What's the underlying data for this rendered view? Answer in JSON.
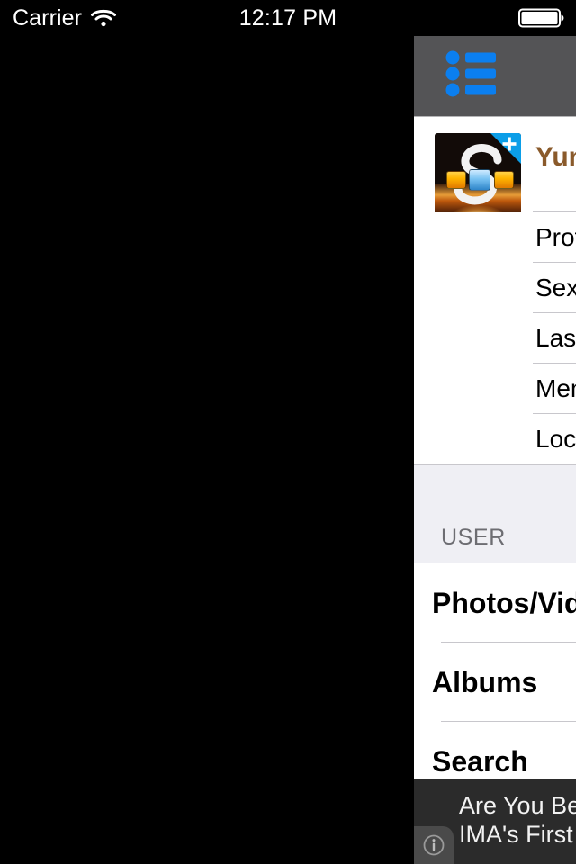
{
  "status_bar": {
    "carrier": "Carrier",
    "wifi_icon": "wifi-icon",
    "time": "12:17 PM",
    "battery_icon": "battery-icon"
  },
  "nav_bar": {
    "background": "#545456",
    "list_button_icon": "list-bullets-icon",
    "icon_color": "#0b7ff0"
  },
  "profile": {
    "avatar_icon": "app-logo-avatar",
    "avatar_badge_icon": "plus-badge-icon",
    "name": "Yunus Emre",
    "name_color": "#8a5a2b"
  },
  "profile_rows": [
    {
      "label": "Profile"
    },
    {
      "label": "Sex"
    },
    {
      "label": "Last Online"
    },
    {
      "label": "Member Since"
    },
    {
      "label": "Location"
    }
  ],
  "section": {
    "title": "USER"
  },
  "user_rows": [
    {
      "label": "Photos/Videos"
    },
    {
      "label": "Albums"
    },
    {
      "label": "Search"
    }
  ],
  "ad_banner": {
    "line_1": "Are You Better Than",
    "line_2": "IMA's First Grader?",
    "info_icon": "info-circle-icon",
    "background": "#2b2b2b"
  }
}
